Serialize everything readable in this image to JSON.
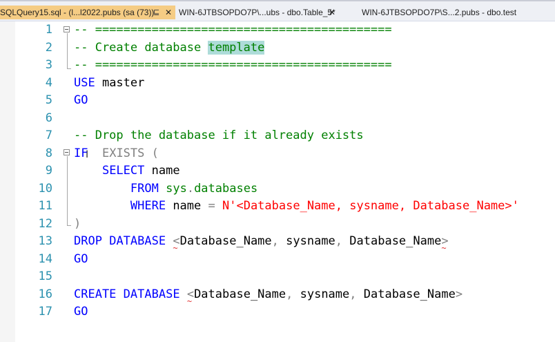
{
  "tabs": [
    {
      "label": "SQLQuery15.sql - (l...l2022.pubs (sa (73))",
      "pin": "⊑",
      "close": "✕",
      "active": true
    },
    {
      "label": "WIN-6JTBSOPDO7P\\...ubs - dbo.Table_5*",
      "close": "✕",
      "active": false
    },
    {
      "label": "WIN-6JTBSOPDO7P\\S...2.pubs - dbo.test",
      "active": false
    }
  ],
  "editor": {
    "lines": [
      {
        "n": "1",
        "parts": [
          {
            "t": "-- ==========================================",
            "c": "cm"
          }
        ]
      },
      {
        "n": "2",
        "parts": [
          {
            "t": "-- Create database ",
            "c": "cm"
          },
          {
            "t": "template",
            "c": "cm hl"
          }
        ]
      },
      {
        "n": "3",
        "parts": [
          {
            "t": "-- ==========================================",
            "c": "cm"
          }
        ]
      },
      {
        "n": "4",
        "parts": [
          {
            "t": "USE",
            "c": "kw"
          },
          {
            "t": " master",
            "c": ""
          }
        ]
      },
      {
        "n": "5",
        "parts": [
          {
            "t": "GO",
            "c": "kw"
          }
        ]
      },
      {
        "n": "6",
        "parts": []
      },
      {
        "n": "7",
        "parts": [
          {
            "t": "-- Drop the database if it already exists",
            "c": "cm"
          }
        ]
      },
      {
        "n": "8",
        "parts": [
          {
            "t": "IF",
            "c": "kw"
          },
          {
            "t": "  ",
            "c": ""
          },
          {
            "t": "EXISTS",
            "c": "gr"
          },
          {
            "t": " (",
            "c": "gr"
          }
        ]
      },
      {
        "n": "9",
        "parts": [
          {
            "t": "    ",
            "c": ""
          },
          {
            "t": "SELECT",
            "c": "kw"
          },
          {
            "t": " name",
            "c": ""
          }
        ]
      },
      {
        "n": "10",
        "parts": [
          {
            "t": "        ",
            "c": ""
          },
          {
            "t": "FROM",
            "c": "kw"
          },
          {
            "t": " ",
            "c": ""
          },
          {
            "t": "sys",
            "c": "sy"
          },
          {
            "t": ".",
            "c": "gr"
          },
          {
            "t": "databases",
            "c": "sy"
          }
        ]
      },
      {
        "n": "11",
        "parts": [
          {
            "t": "        ",
            "c": ""
          },
          {
            "t": "WHERE",
            "c": "kw"
          },
          {
            "t": " name ",
            "c": ""
          },
          {
            "t": "=",
            "c": "gr"
          },
          {
            "t": " ",
            "c": ""
          },
          {
            "t": "N'<Database_Name, sysname, Database_Name>'",
            "c": "st"
          }
        ]
      },
      {
        "n": "12",
        "parts": [
          {
            "t": ")",
            "c": "gr"
          }
        ]
      },
      {
        "n": "13",
        "parts": [
          {
            "t": "DROP",
            "c": "kw"
          },
          {
            "t": " ",
            "c": ""
          },
          {
            "t": "DATABASE",
            "c": "kw"
          },
          {
            "t": " ",
            "c": ""
          },
          {
            "t": "<",
            "c": "gr sq"
          },
          {
            "t": "Database_Name",
            "c": ""
          },
          {
            "t": ", ",
            "c": "gr"
          },
          {
            "t": "sysname",
            "c": ""
          },
          {
            "t": ", ",
            "c": "gr"
          },
          {
            "t": "Database_Name",
            "c": ""
          },
          {
            "t": ">",
            "c": "gr sq"
          }
        ]
      },
      {
        "n": "14",
        "parts": [
          {
            "t": "GO",
            "c": "kw"
          }
        ]
      },
      {
        "n": "15",
        "parts": []
      },
      {
        "n": "16",
        "parts": [
          {
            "t": "CREATE",
            "c": "kw"
          },
          {
            "t": " ",
            "c": ""
          },
          {
            "t": "DATABASE",
            "c": "kw"
          },
          {
            "t": " ",
            "c": ""
          },
          {
            "t": "<",
            "c": "gr sq"
          },
          {
            "t": "Database_Name",
            "c": ""
          },
          {
            "t": ", ",
            "c": "gr"
          },
          {
            "t": "sysname",
            "c": ""
          },
          {
            "t": ", ",
            "c": "gr"
          },
          {
            "t": "Database_Name",
            "c": ""
          },
          {
            "t": ">",
            "c": "gr"
          }
        ]
      },
      {
        "n": "17",
        "parts": [
          {
            "t": "GO",
            "c": "kw"
          }
        ]
      }
    ]
  },
  "colors": {
    "active_tab": "#f5cc84",
    "keyword": "#0000ff",
    "comment": "#008000",
    "string": "#ff0000",
    "line_number": "#2b91af",
    "highlight": "#aedcd9"
  },
  "icons": {
    "pin": "pin-icon",
    "close": "close-icon",
    "fold": "collapse-icon",
    "cursor": "text-cursor-icon"
  }
}
